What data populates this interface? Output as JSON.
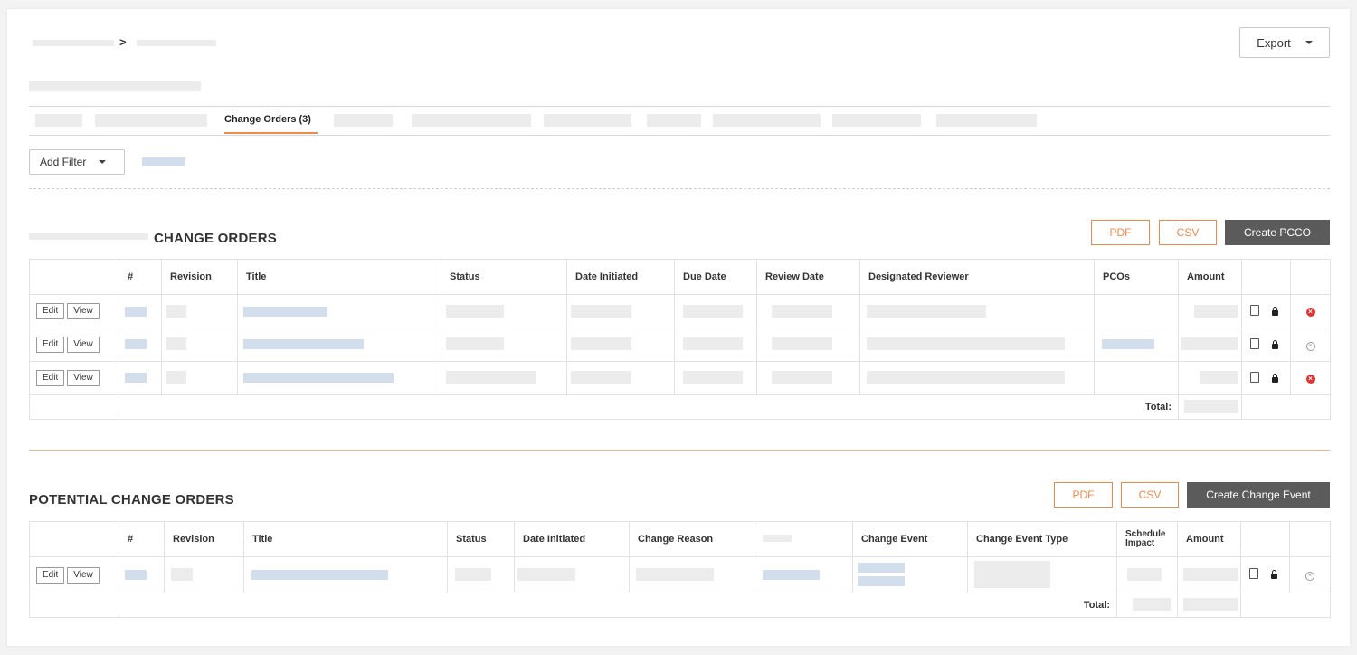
{
  "header": {
    "breadcrumb_sep": ">",
    "export_label": "Export"
  },
  "tabs": {
    "active_label": "Change Orders (3)"
  },
  "filter": {
    "add_filter_label": "Add Filter"
  },
  "change_orders": {
    "title": "CHANGE ORDERS",
    "pdf_label": "PDF",
    "csv_label": "CSV",
    "create_label": "Create PCCO",
    "columns": [
      "#",
      "Revision",
      "Title",
      "Status",
      "Date Initiated",
      "Due Date",
      "Review Date",
      "Designated Reviewer",
      "PCOs",
      "Amount"
    ],
    "edit_label": "Edit",
    "view_label": "View",
    "total_label": "Total:"
  },
  "potential_change_orders": {
    "title": "POTENTIAL CHANGE ORDERS",
    "pdf_label": "PDF",
    "csv_label": "CSV",
    "create_label": "Create Change Event",
    "columns": [
      "#",
      "Revision",
      "Title",
      "Status",
      "Date Initiated",
      "Change Reason",
      "",
      "Change Event",
      "Change Event Type",
      "Schedule Impact",
      "Amount"
    ],
    "edit_label": "Edit",
    "view_label": "View",
    "total_label": "Total:"
  },
  "colors": {
    "accent": "#f08a4b",
    "dark_button": "#5b5b5b",
    "delete_red": "#dd3333",
    "link_placeholder": "#d3deed"
  },
  "icons": [
    "chevron-right-icon",
    "caret-down-icon",
    "pdf-icon",
    "lock-icon",
    "delete-icon",
    "delete-disabled-icon"
  ]
}
